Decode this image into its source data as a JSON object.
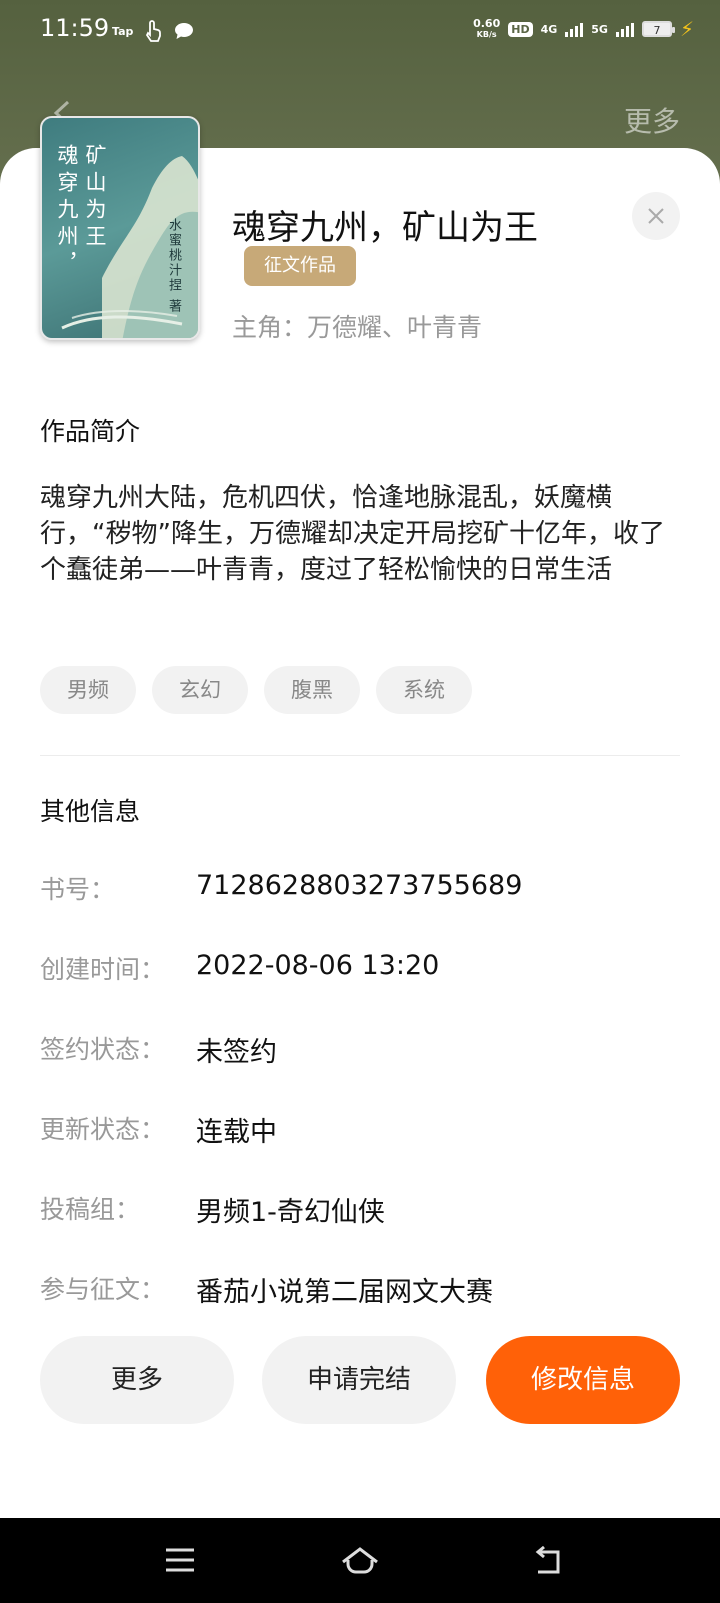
{
  "status_bar": {
    "time": "11:59",
    "left_icons": [
      "Tap",
      "touch-icon",
      "chat-bubble-icon"
    ],
    "net_speed_top": "0.60",
    "net_speed_bottom": "KB/s",
    "hd_label": "HD",
    "network_4g": "4G",
    "network_5g": "5G",
    "battery": "7"
  },
  "header": {
    "more_label": "更多"
  },
  "book": {
    "cover_col1": "魂穿九州，",
    "cover_col2": "矿山为王",
    "cover_author": "水蜜桃汁捏 著",
    "title": "魂穿九州，矿山为王",
    "contest_tag": "征文作品",
    "protagonist": "主角：万德耀、叶青青"
  },
  "intro": {
    "heading": "作品简介",
    "text": "魂穿九州大陆，危机四伏，恰逢地脉混乱，妖魔横行，“秽物”降生，万德耀却决定开局挖矿十亿年，收了个蠢徒弟——叶青青，度过了轻松愉快的日常生活",
    "tags": [
      "男频",
      "玄幻",
      "腹黑",
      "系统"
    ]
  },
  "other_info": {
    "heading": "其他信息",
    "rows": [
      {
        "label": "书号：",
        "value": "7128628803273755689"
      },
      {
        "label": "创建时间：",
        "value": "2022-08-06 13:20"
      },
      {
        "label": "签约状态：",
        "value": "未签约"
      },
      {
        "label": "更新状态：",
        "value": "连载中"
      },
      {
        "label": "投稿组：",
        "value": "男频1-奇幻仙侠"
      },
      {
        "label": "参与征文：",
        "value": "番茄小说第二届网文大赛"
      }
    ]
  },
  "actions": {
    "more": "更多",
    "apply_finish": "申请完结",
    "edit_info": "修改信息"
  },
  "colors": {
    "accent_orange": "#ff6108",
    "contest_gold": "#c7a978",
    "header_green": "#66704f"
  }
}
